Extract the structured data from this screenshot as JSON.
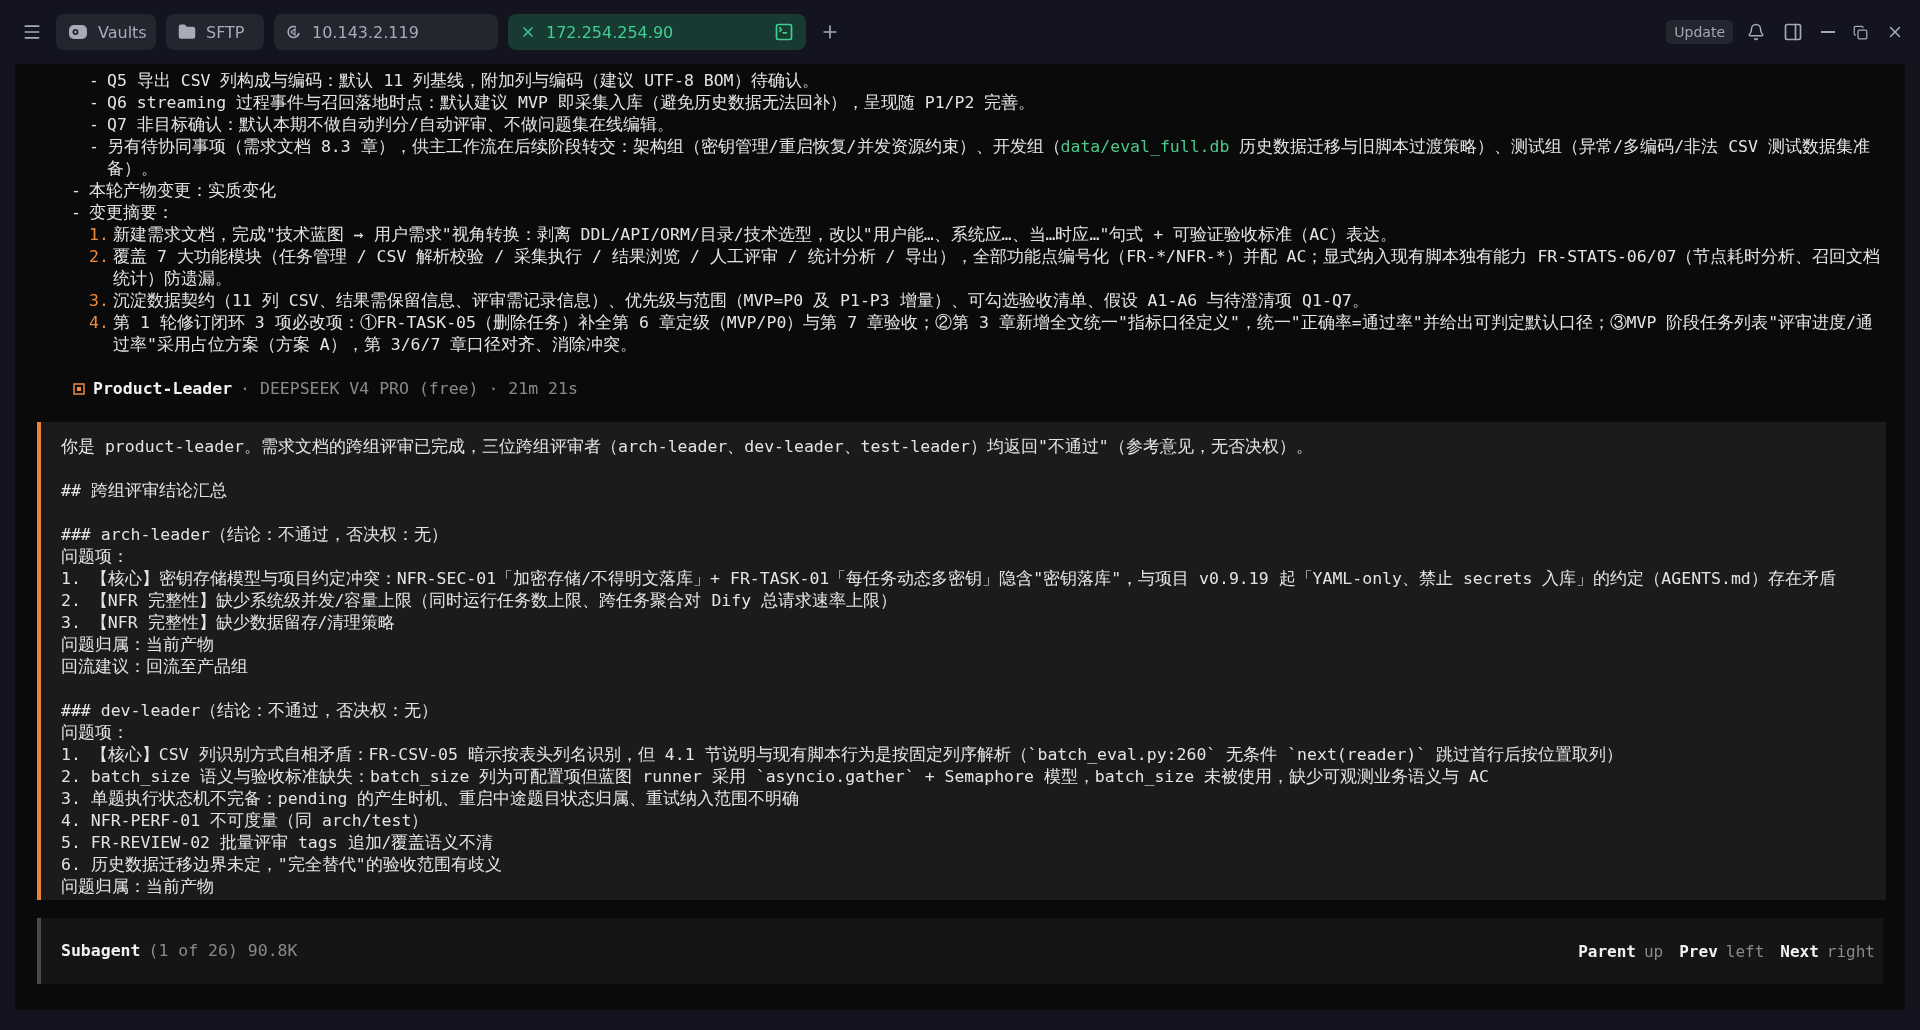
{
  "titlebar": {
    "tabs": [
      {
        "label": "Vaults",
        "kind": "vaults",
        "selected": false
      },
      {
        "label": "SFTP",
        "kind": "folder",
        "selected": false
      },
      {
        "label": "10.143.2.119",
        "kind": "host",
        "selected": false
      },
      {
        "label": "172.254.254.90",
        "kind": "host",
        "selected": true
      }
    ],
    "update_button": "Update"
  },
  "transcript": {
    "continued_items": [
      {
        "marker": "-",
        "segments": [
          {
            "text": "Q5 导出 CSV 列构成与编码：默认 11 列基线，附加列与编码（建议 UTF-8 BOM）待确认。"
          }
        ]
      },
      {
        "marker": "-",
        "segments": [
          {
            "text": "Q6 streaming 过程事件与召回落地时点：默认建议 MVP 即采集入库（避免历史数据无法回补），呈现随 P1/P2 完善。"
          }
        ]
      },
      {
        "marker": "-",
        "segments": [
          {
            "text": "Q7 非目标确认：默认本期不做自动判分/自动评审、不做问题集在线编辑。"
          }
        ]
      },
      {
        "marker": "-",
        "segments": [
          {
            "text": "另有待协同事项（需求文档 8.3 章），供主工作流在后续阶段转交：架构组（密钥管理/重启恢复/并发资源约束）、开发组（"
          },
          {
            "text": "data/eval_full.db",
            "kind": "path"
          },
          {
            "text": " 历史数据迁移与旧脚本过渡策略）、测试组（异常/多编码/非法 CSV 测试数据集准备）。"
          }
        ]
      }
    ],
    "items": [
      {
        "marker": "-",
        "text": "本轮产物变更：实质变化"
      },
      {
        "marker": "-",
        "text": "变更摘要：",
        "children": [
          {
            "marker": "1.",
            "text": "新建需求文档，完成\"技术蓝图 → 用户需求\"视角转换：剥离 DDL/API/ORM/目录/技术选型，改以\"用户能…、系统应…、当…时应…\"句式 + 可验证验收标准（AC）表达。"
          },
          {
            "marker": "2.",
            "text": "覆盖 7 大功能模块（任务管理 / CSV 解析校验 / 采集执行 / 结果浏览 / 人工评审 / 统计分析 / 导出），全部功能点编号化（FR-*/NFR-*）并配 AC；显式纳入现有脚本独有能力 FR-STATS-06/07（节点耗时分析、召回文档统计）防遗漏。"
          },
          {
            "marker": "3.",
            "text": "沉淀数据契约（11 列 CSV、结果需保留信息、评审需记录信息）、优先级与范围（MVP=P0 及 P1-P3 增量）、可勾选验收清单、假设 A1-A6 与待澄清项 Q1-Q7。"
          },
          {
            "marker": "4.",
            "text": "第 1 轮修订闭环 3 项必改项：①FR-TASK-05（删除任务）补全第 6 章定级（MVP/P0）与第 7 章验收；②第 3 章新增全文统一\"指标口径定义\"，统一\"正确率=通过率\"并给出可判定默认口径；③MVP 阶段任务列表\"评审进度/通过率\"采用占位方案（方案 A），第 3/6/7 章口径对齐、消除冲突。"
          }
        ]
      }
    ],
    "agent": {
      "name": "Product-Leader",
      "meta": "· DEEPSEEK V4 PRO (free) · 21m 21s"
    }
  },
  "prompt": {
    "lines": [
      {
        "kind": "text",
        "text": "你是 product-leader。需求文档的跨组评审已完成，三位跨组评审者（arch-leader、dev-leader、test-leader）均返回\"不通过\"（参考意见，无否决权）。"
      },
      {
        "kind": "blank"
      },
      {
        "kind": "text",
        "text": "## 跨组评审结论汇总"
      },
      {
        "kind": "blank"
      },
      {
        "kind": "text",
        "text": "### arch-leader（结论：不通过，否决权：无）"
      },
      {
        "kind": "text",
        "text": "问题项："
      },
      {
        "kind": "text",
        "text": "1. 【核心】密钥存储模型与项目约定冲突：NFR-SEC-01「加密存储/不得明文落库」+ FR-TASK-01「每任务动态多密钥」隐含\"密钥落库\"，与项目 v0.9.19 起「YAML-only、禁止 secrets 入库」的约定（AGENTS.md）存在矛盾"
      },
      {
        "kind": "text",
        "text": "2. 【NFR 完整性】缺少系统级并发/容量上限（同时运行任务数上限、跨任务聚合对 Dify 总请求速率上限）"
      },
      {
        "kind": "text",
        "text": "3. 【NFR 完整性】缺少数据留存/清理策略"
      },
      {
        "kind": "text",
        "text": "问题归属：当前产物"
      },
      {
        "kind": "text",
        "text": "回流建议：回流至产品组"
      },
      {
        "kind": "blank"
      },
      {
        "kind": "text",
        "text": "### dev-leader（结论：不通过，否决权：无）"
      },
      {
        "kind": "text",
        "text": "问题项："
      },
      {
        "kind": "text",
        "text": "1. 【核心】CSV 列识别方式自相矛盾：FR-CSV-05 暗示按表头列名识别，但 4.1 节说明与现有脚本行为是按固定列序解析（`batch_eval.py:260` 无条件 `next(reader)` 跳过首行后按位置取列）"
      },
      {
        "kind": "text",
        "text": "2. batch_size 语义与验收标准缺失：batch_size 列为可配置项但蓝图 runner 采用 `asyncio.gather` + Semaphore 模型，batch_size 未被使用，缺少可观测业务语义与 AC"
      },
      {
        "kind": "text",
        "text": "3. 单题执行状态机不完备：pending 的产生时机、重启中途题目状态归属、重试纳入范围不明确"
      },
      {
        "kind": "text",
        "text": "4. NFR-PERF-01 不可度量（同 arch/test）"
      },
      {
        "kind": "text",
        "text": "5. FR-REVIEW-02 批量评审 tags 追加/覆盖语义不清"
      },
      {
        "kind": "text",
        "text": "6. 历史数据迁移边界未定，\"完全替代\"的验收范围有歧义"
      },
      {
        "kind": "text",
        "text": "问题归属：当前产物"
      }
    ]
  },
  "footer": {
    "title": "Subagent",
    "info": "(1 of 26) 90.8K",
    "nav": [
      {
        "key": "Parent",
        "hint": "up"
      },
      {
        "key": "Prev",
        "hint": "left"
      },
      {
        "key": "Next",
        "hint": "right"
      }
    ]
  }
}
